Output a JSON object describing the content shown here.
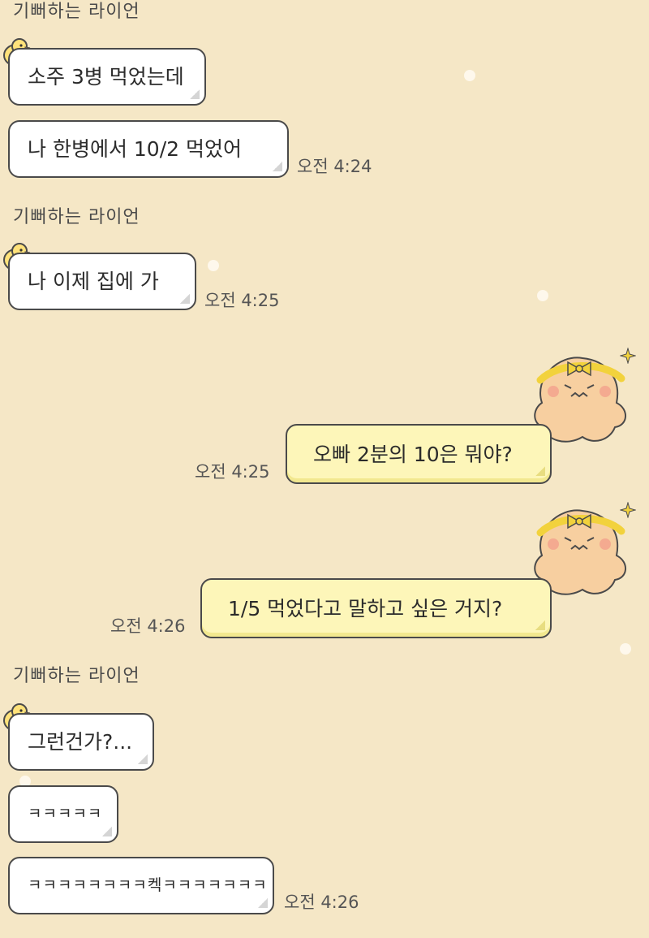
{
  "chat": {
    "sender_name": "기뻐하는 라이언",
    "messages": [
      {
        "text": "소주 3병 먹었는데"
      },
      {
        "text": "나 한병에서 10/2 먹었어",
        "time": "오전 4:24"
      },
      {
        "text": "나 이제 집에 가",
        "time": "오전 4:25"
      },
      {
        "text": "오빠 2분의 10은 뭐야?",
        "time": "오전 4:25"
      },
      {
        "text": "1/5 먹었다고 말하고 싶은 거지?",
        "time": "오전 4:26"
      },
      {
        "text": "그런건가?..."
      },
      {
        "text": "ㅋㅋㅋㅋㅋ"
      },
      {
        "text": "ㅋㅋㅋㅋㅋㅋㅋㅋ켁ㅋㅋㅋㅋㅋㅋㅋ",
        "time": "오전 4:26"
      }
    ]
  },
  "theme": {
    "background": "#f5e7c6",
    "incoming_bubble": "#ffffff",
    "outgoing_bubble": "#fdf6b9",
    "bubble_border": "#4a4a4a"
  },
  "icons": {
    "incoming_profile": "chick-icon",
    "outgoing_decoration": "bear-character-icon",
    "sparkle": "sparkle-icon"
  }
}
